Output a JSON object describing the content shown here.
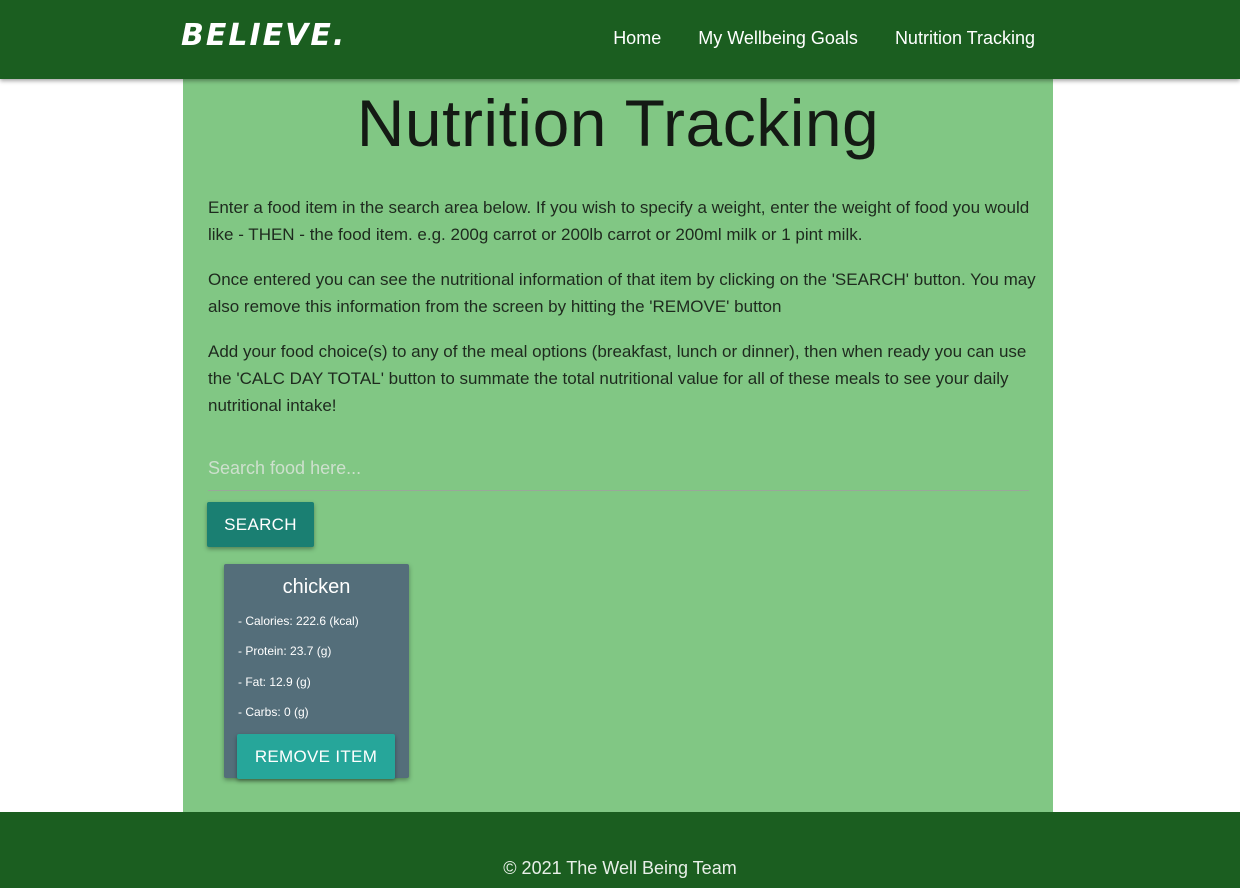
{
  "nav": {
    "brand": "BELIEVE.",
    "links": [
      "Home",
      "My Wellbeing Goals",
      "Nutrition Tracking"
    ]
  },
  "main": {
    "title": "Nutrition Tracking",
    "paragraphs": [
      "Enter a food item in the search area below. If you wish to specify a weight, enter the weight of food you would like - THEN - the food item. e.g. 200g carrot or 200lb carrot or 200ml milk or 1 pint milk.",
      "Once entered you can see the nutritional information of that item by clicking on the 'SEARCH' button. You may also remove this information from the screen by hitting the 'REMOVE' button",
      "Add your food choice(s) to any of the meal options (breakfast, lunch or dinner), then when ready you can use the 'CALC DAY TOTAL' button to summate the total nutritional value for all of these meals to see your daily nutritional intake!"
    ],
    "search": {
      "placeholder": "Search food here...",
      "value": "",
      "button_label": "SEARCH"
    },
    "food_card": {
      "name": "chicken",
      "nutrients": [
        "- Calories: 222.6 (kcal)",
        "- Protein: 23.7 (g)",
        "- Fat: 12.9 (g)",
        "- Carbs: 0 (g)"
      ],
      "remove_label": "REMOVE ITEM"
    }
  },
  "footer": {
    "text": "© 2021 The Well Being Team"
  },
  "colors": {
    "nav_bg": "#1b5e20",
    "main_bg": "#81c784",
    "search_button": "#1a7f72",
    "card_bg": "#546e7a",
    "remove_button": "#26a69a"
  }
}
